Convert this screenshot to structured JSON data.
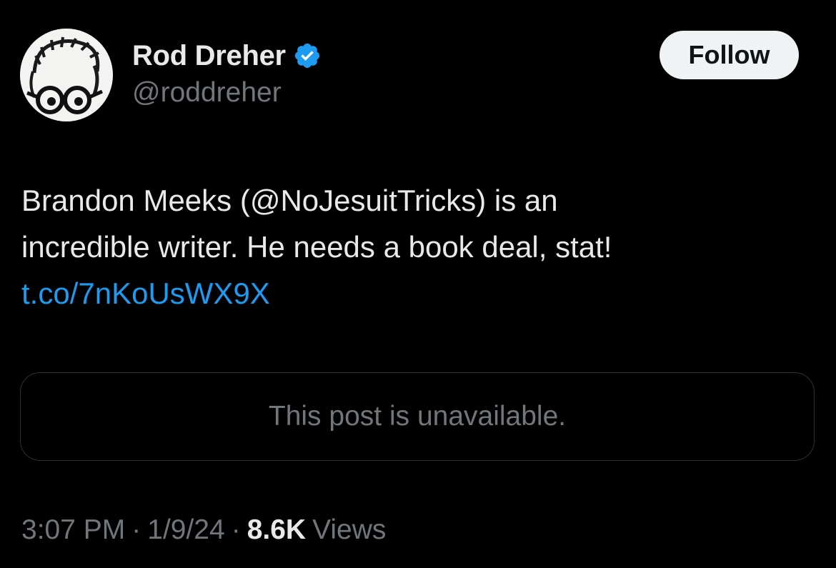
{
  "author": {
    "display_name": "Rod Dreher",
    "handle": "@roddreher",
    "verified_icon": "verified-badge-icon",
    "verified_color": "#1d9bf0"
  },
  "follow_button": {
    "label": "Follow"
  },
  "tweet": {
    "lines": [
      "Brandon Meeks (@NoJesuitTricks) is an",
      "incredible writer. He needs a book deal, stat!"
    ],
    "link": "t.co/7nKoUsWX9X",
    "link_color": "#1d9bf0"
  },
  "quoted_post": {
    "message": "This post is unavailable."
  },
  "meta": {
    "time": "3:07 PM",
    "separator": "·",
    "date": "1/9/24",
    "views_count": "8.6K",
    "views_label": "Views"
  },
  "colors": {
    "background": "#000000",
    "primary_text": "#e7e9ea",
    "secondary_text": "#71767b",
    "border": "#2f3336",
    "button_bg": "#eff3f4"
  }
}
